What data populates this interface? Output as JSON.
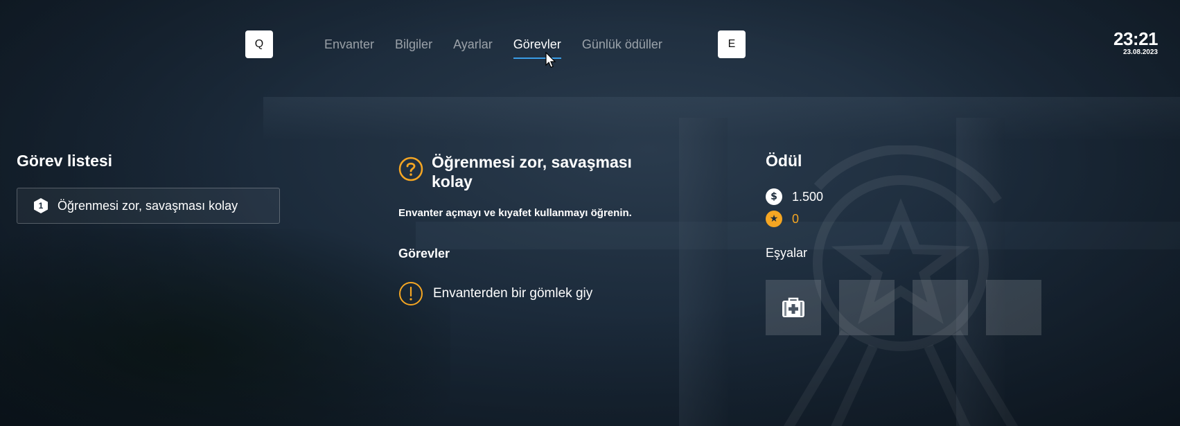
{
  "nav": {
    "prev_key": "Q",
    "next_key": "E",
    "tabs": [
      {
        "label": "Envanter",
        "active": false
      },
      {
        "label": "Bilgiler",
        "active": false
      },
      {
        "label": "Ayarlar",
        "active": false
      },
      {
        "label": "Görevler",
        "active": true
      },
      {
        "label": "Günlük ödüller",
        "active": false
      }
    ],
    "accent_color": "#3a9ee8"
  },
  "clock": {
    "time": "23:21",
    "date": "23.08.2023"
  },
  "task_list": {
    "title": "Görev listesi",
    "items": [
      {
        "number": "1",
        "label": "Öğrenmesi zor, savaşması kolay"
      }
    ]
  },
  "mission": {
    "title": "Öğrenmesi zor, savaşması kolay",
    "description": "Envanter açmayı ve kıyafet kullanmayı öğrenin.",
    "objectives_title": "Görevler",
    "objectives": [
      {
        "label": "Envanterden bir gömlek giy",
        "icon": "exclamation-circle-icon"
      }
    ],
    "icon": "question-circle-icon",
    "icon_color": "#f5a623"
  },
  "reward": {
    "title": "Ödül",
    "money": "1.500",
    "xp": "0",
    "items_label": "Eşyalar",
    "slots": [
      {
        "icon": "medkit-icon"
      },
      {
        "icon": ""
      },
      {
        "icon": ""
      },
      {
        "icon": ""
      }
    ],
    "xp_color": "#f5a623"
  }
}
